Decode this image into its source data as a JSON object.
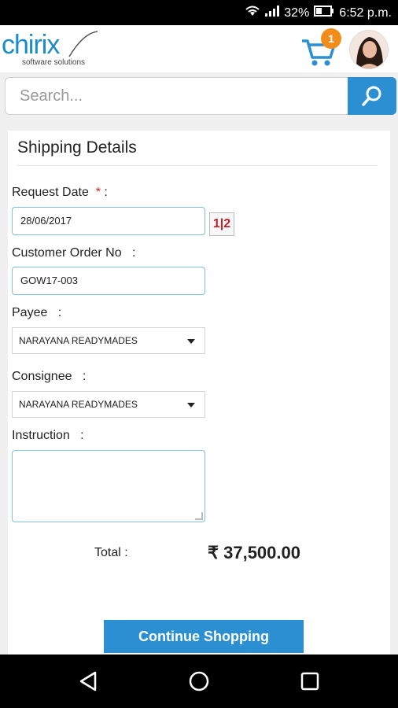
{
  "status_bar": {
    "battery": "32%",
    "time": "6:52 p.m."
  },
  "header": {
    "logo_main": "chirix",
    "logo_sub": "software solutions",
    "cart_count": "1"
  },
  "search": {
    "placeholder": "Search..."
  },
  "form": {
    "title": "Shipping Details",
    "request_date_label": "Request Date",
    "required_mark": "*",
    "colon": ":",
    "request_date_value": "28/06/2017",
    "customer_order_label": "Customer Order No",
    "customer_order_value": "GOW17-003",
    "payee_label": "Payee",
    "payee_value": "NARAYANA READYMADES",
    "consignee_label": "Consignee",
    "consignee_value": "NARAYANA READYMADES",
    "instruction_label": "Instruction",
    "instruction_value": "",
    "calendar_icon_text": "1|2"
  },
  "summary": {
    "total_label": "Total :",
    "total_value": "₹ 37,500.00"
  },
  "actions": {
    "continue_label": "Continue Shopping"
  },
  "colors": {
    "primary": "#2b8fd1",
    "badge": "#f28c1a",
    "required": "#e02020"
  },
  "icons": [
    "wifi-icon",
    "signal-icon",
    "battery-icon",
    "cart-icon",
    "search-icon",
    "calendar-icon",
    "back-icon",
    "home-icon",
    "recents-icon"
  ]
}
